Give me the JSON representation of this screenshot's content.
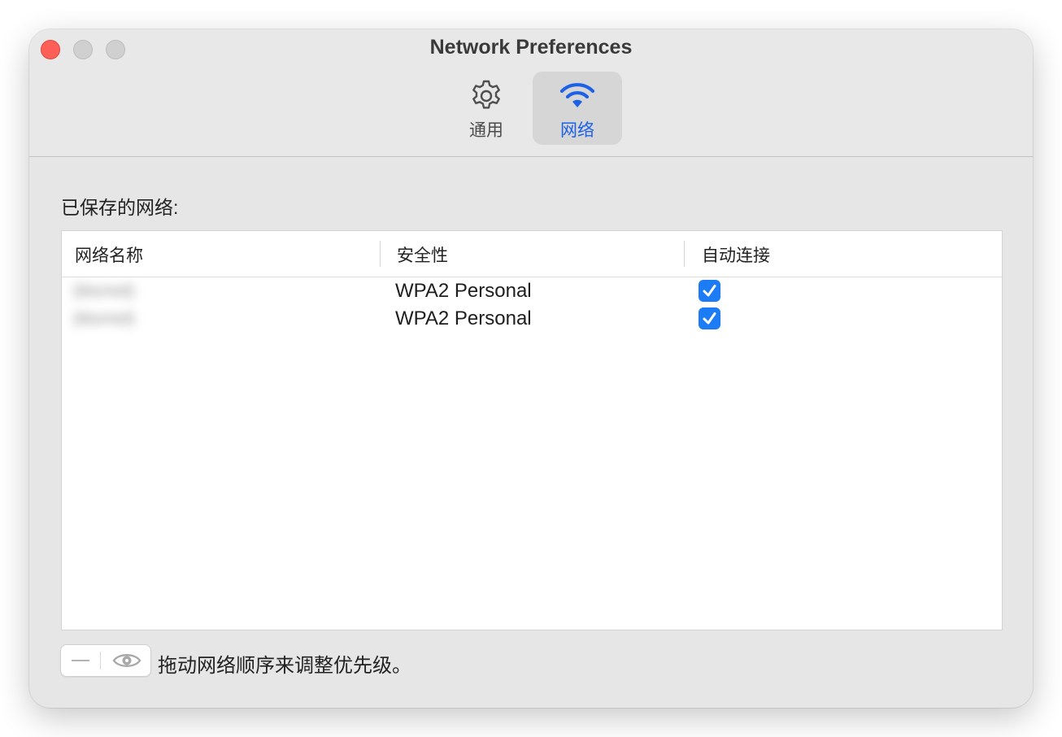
{
  "window": {
    "title": "Network Preferences"
  },
  "toolbar": {
    "tabs": [
      {
        "label": "通用",
        "icon": "gear-icon",
        "active": false
      },
      {
        "label": "网络",
        "icon": "wifi-icon",
        "active": true
      }
    ]
  },
  "saved_networks": {
    "section_title": "已保存的网络:",
    "columns": [
      "网络名称",
      "安全性",
      "自动连接"
    ],
    "rows": [
      {
        "name": "(blurred)",
        "security": "WPA2 Personal",
        "auto_join": true
      },
      {
        "name": "(blurred)",
        "security": "WPA2 Personal",
        "auto_join": true
      }
    ]
  },
  "footer": {
    "remove_icon": "minus-icon",
    "view_icon": "eye-icon",
    "hint": "拖动网络顺序来调整优先级。"
  },
  "colors": {
    "accent": "#1b7cf5",
    "active_tab_text": "#1d62e6",
    "close_button": "#fe5f57"
  }
}
